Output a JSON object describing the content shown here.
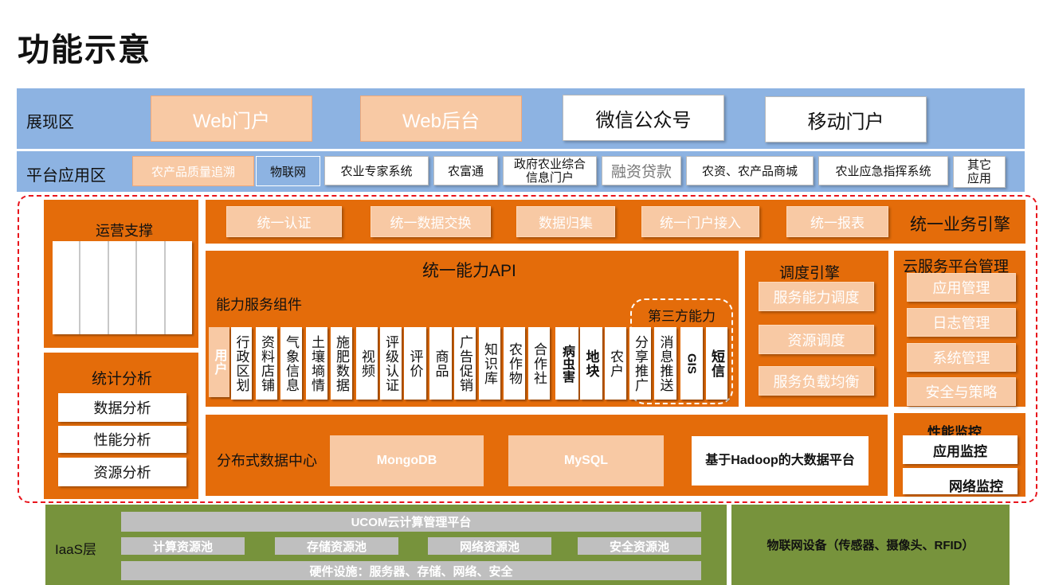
{
  "title": "功能示意",
  "display_zone": {
    "label": "展现区",
    "items": [
      "Web门户",
      "Web后台",
      "微信公众号",
      "移动门户"
    ]
  },
  "platform_zone": {
    "label": "平台应用区",
    "items": [
      "农产品质量追溯",
      "物联网",
      "农业专家系统",
      "农富通",
      "政府农业综合信息门户",
      "融资贷款",
      "农资、农产品商城",
      "农业应急指挥系统",
      "其它应用"
    ]
  },
  "ops_support": {
    "label": "运营支撑"
  },
  "stats": {
    "label": "统计分析",
    "items": [
      "数据分析",
      "性能分析",
      "资源分析"
    ]
  },
  "business_engine": {
    "label": "统一业务引擎",
    "items": [
      "统一认证",
      "统一数据交换",
      "数据归集",
      "统一门户接入",
      "统一报表"
    ]
  },
  "capability_api": {
    "label": "统一能力API",
    "components_label": "能力服务组件",
    "third_party_label": "第三方能力",
    "components": [
      "用户",
      "行政区划",
      "资料店铺",
      "气象信息",
      "土壤墒情",
      "施肥数据",
      "视频",
      "评级认证",
      "评价",
      "商品",
      "广告促销",
      "知识库",
      "农作物",
      "合作社",
      "病虫害",
      "地块",
      "农户",
      "分享推广",
      "消息推送",
      "GIS",
      "短信"
    ]
  },
  "scheduler": {
    "label": "调度引擎",
    "items": [
      "服务能力调度",
      "资源调度",
      "服务负载均衡"
    ]
  },
  "cloud_mgmt": {
    "label": "云服务平台管理",
    "items": [
      "应用管理",
      "日志管理",
      "系统管理",
      "安全与策略"
    ]
  },
  "data_center": {
    "label": "分布式数据中心",
    "items": [
      "MongoDB",
      "MySQL",
      "基于Hadoop的大数据平台"
    ]
  },
  "perf_monitor": {
    "label": "性能监控",
    "items": [
      "应用监控",
      "网络监控"
    ]
  },
  "iaas": {
    "label": "IaaS层",
    "platform": "UCOM云计算管理平台",
    "pools": [
      "计算资源池",
      "存储资源池",
      "网络资源池",
      "安全资源池"
    ],
    "hardware": "硬件设施：服务器、存储、网络、安全"
  },
  "iot": {
    "label": "物联网设备（传感器、摄像头、RFID）"
  },
  "colors": {
    "band_blue": "#8db3e2",
    "orange": "#e46c0a",
    "peach": "#f8c9a4",
    "green": "#77933c",
    "dashed_red": "#e8141c"
  }
}
